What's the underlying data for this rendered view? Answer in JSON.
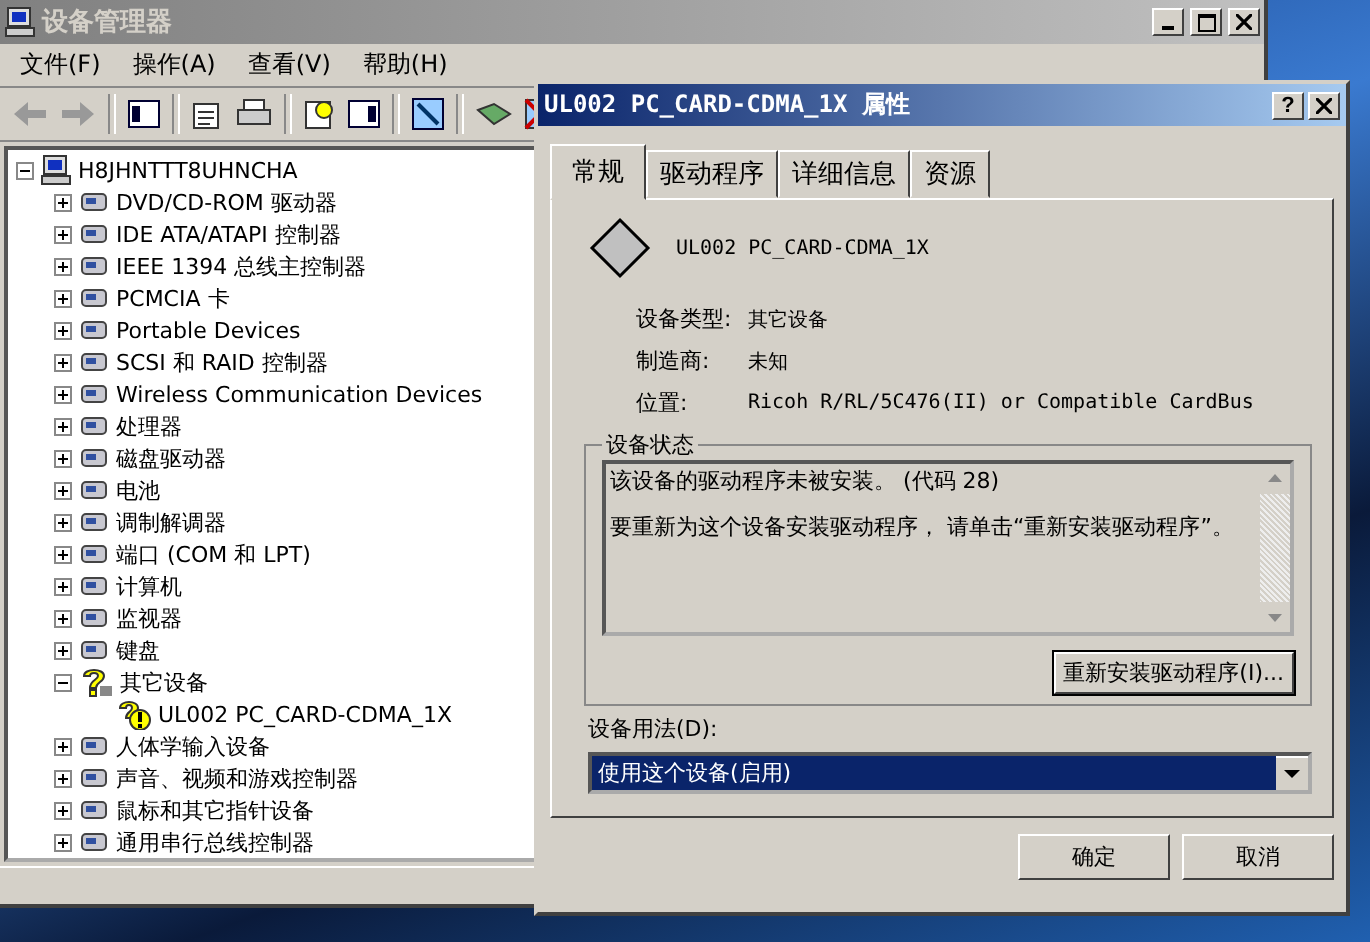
{
  "main_window": {
    "title": "设备管理器",
    "menu": [
      "文件(F)",
      "操作(A)",
      "查看(V)",
      "帮助(H)"
    ],
    "tree": {
      "label": "H8JHNTTT8UHNCHA",
      "kind": "computer",
      "expanded": true,
      "children": [
        {
          "label": "DVD/CD-ROM 驱动器",
          "kind": "device",
          "expanded": false
        },
        {
          "label": "IDE ATA/ATAPI 控制器",
          "kind": "device",
          "expanded": false
        },
        {
          "label": "IEEE 1394 总线主控制器",
          "kind": "device",
          "expanded": false
        },
        {
          "label": "PCMCIA 卡",
          "kind": "device",
          "expanded": false
        },
        {
          "label": "Portable Devices",
          "kind": "device",
          "expanded": false
        },
        {
          "label": "SCSI 和 RAID 控制器",
          "kind": "device",
          "expanded": false
        },
        {
          "label": "Wireless Communication Devices",
          "kind": "device",
          "expanded": false
        },
        {
          "label": "处理器",
          "kind": "device",
          "expanded": false
        },
        {
          "label": "磁盘驱动器",
          "kind": "device",
          "expanded": false
        },
        {
          "label": "电池",
          "kind": "device",
          "expanded": false
        },
        {
          "label": "调制解调器",
          "kind": "device",
          "expanded": false
        },
        {
          "label": "端口 (COM 和 LPT)",
          "kind": "device",
          "expanded": false
        },
        {
          "label": "计算机",
          "kind": "device",
          "expanded": false
        },
        {
          "label": "监视器",
          "kind": "device",
          "expanded": false
        },
        {
          "label": "键盘",
          "kind": "device",
          "expanded": false
        },
        {
          "label": "其它设备",
          "kind": "unknown",
          "expanded": true,
          "children": [
            {
              "label": "UL002 PC_CARD-CDMA_1X",
              "kind": "warning"
            }
          ]
        },
        {
          "label": "人体学输入设备",
          "kind": "device",
          "expanded": false
        },
        {
          "label": "声音、视频和游戏控制器",
          "kind": "device",
          "expanded": false
        },
        {
          "label": "鼠标和其它指针设备",
          "kind": "device",
          "expanded": false
        },
        {
          "label": "通用串行总线控制器",
          "kind": "device",
          "expanded": false
        }
      ]
    }
  },
  "dialog": {
    "title": "UL002 PC_CARD-CDMA_1X 属性",
    "help": "?",
    "tabs": [
      {
        "label": "常规",
        "selected": true
      },
      {
        "label": "驱动程序",
        "selected": false
      },
      {
        "label": "详细信息",
        "selected": false
      },
      {
        "label": "资源",
        "selected": false
      }
    ],
    "device_name": "UL002 PC_CARD-CDMA_1X",
    "properties": [
      {
        "label": "设备类型:",
        "value": "其它设备"
      },
      {
        "label": "制造商:",
        "value": "未知"
      },
      {
        "label": "位置:",
        "value": "Ricoh R/RL/5C476(II) or Compatible CardBus"
      }
    ],
    "status_group": "设备状态",
    "status_text": [
      "该设备的驱动程序未被安装。 (代码 28)",
      "要重新为这个设备安装驱动程序， 请单击“重新安装驱动程序”。"
    ],
    "reinstall_button": "重新安装驱动程序(I)...",
    "usage_label": "设备用法(D):",
    "usage_value": "使用这个设备(启用)",
    "buttons": [
      "确定",
      "取消"
    ]
  }
}
